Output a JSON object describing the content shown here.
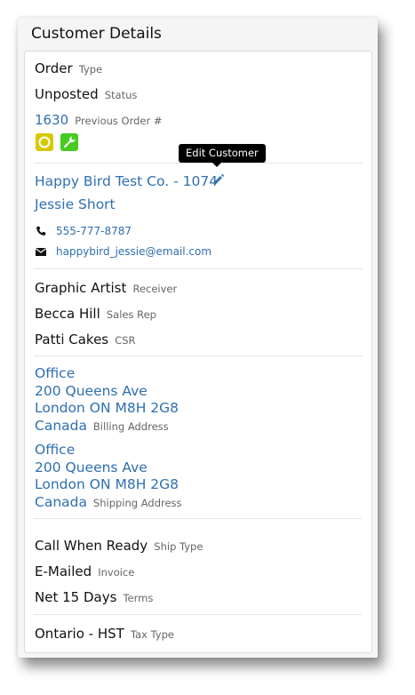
{
  "title": "Customer Details",
  "order": {
    "type_value": "Order",
    "type_label": "Type",
    "status_value": "Unposted",
    "status_label": "Status",
    "previous_order_value": "1630",
    "previous_order_label": "Previous Order #"
  },
  "badges": {
    "circle_color": "#d6c800",
    "wrench_color": "#44cc1f"
  },
  "tooltip": "Edit Customer",
  "customer": {
    "company": "Happy Bird Test Co. - 1074",
    "contact_name": "Jessie Short",
    "phone": "555-777-8787",
    "email": "happybird_jessie@email.com"
  },
  "people": {
    "receiver_value": "Graphic Artist",
    "receiver_label": "Receiver",
    "sales_rep_value": "Becca Hill",
    "sales_rep_label": "Sales Rep",
    "csr_value": "Patti Cakes",
    "csr_label": "CSR"
  },
  "billing": {
    "line1": "Office",
    "line2": "200 Queens Ave",
    "line3": "London ON M8H 2G8",
    "country": "Canada",
    "label": "Billing Address"
  },
  "shipping": {
    "line1": "Office",
    "line2": "200 Queens Ave",
    "line3": "London ON M8H 2G8",
    "country": "Canada",
    "label": "Shipping Address"
  },
  "shipping_info": {
    "ship_type_value": "Call When Ready",
    "ship_type_label": "Ship Type",
    "invoice_value": "E-Mailed",
    "invoice_label": "Invoice",
    "terms_value": "Net 15 Days",
    "terms_label": "Terms"
  },
  "tax": {
    "value": "Ontario - HST",
    "label": "Tax Type"
  },
  "colors": {
    "link": "#2f6fb0",
    "tooltip_bg": "#000000"
  }
}
